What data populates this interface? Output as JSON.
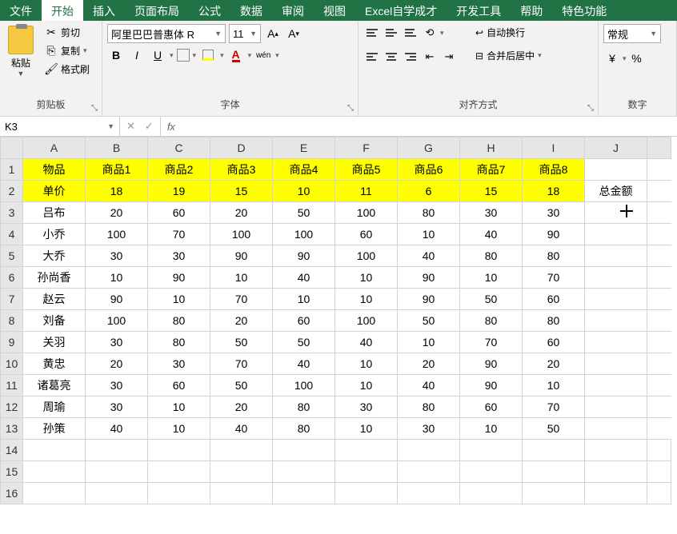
{
  "menubar": {
    "tabs": [
      "文件",
      "开始",
      "插入",
      "页面布局",
      "公式",
      "数据",
      "审阅",
      "视图",
      "Excel自学成才",
      "开发工具",
      "帮助",
      "特色功能"
    ],
    "active_index": 1
  },
  "ribbon": {
    "clipboard": {
      "paste": "粘贴",
      "cut": "剪切",
      "copy": "复制",
      "format_painter": "格式刷",
      "group_label": "剪贴板"
    },
    "font": {
      "family": "阿里巴巴普惠体 R",
      "size": "11",
      "group_label": "字体",
      "wen_label": "wén"
    },
    "alignment": {
      "wrap_text": "自动换行",
      "merge_center": "合并后居中",
      "group_label": "对齐方式"
    },
    "number": {
      "format": "常规",
      "group_label": "数字"
    }
  },
  "name_box": "K3",
  "fx_label": "fx",
  "columns": [
    "A",
    "B",
    "C",
    "D",
    "E",
    "F",
    "G",
    "H",
    "I",
    "J"
  ],
  "row_count": 16,
  "header_row": {
    "label": "物品",
    "items": [
      "商品1",
      "商品2",
      "商品3",
      "商品4",
      "商品5",
      "商品6",
      "商品7",
      "商品8"
    ]
  },
  "price_row": {
    "label": "单价",
    "values": [
      18,
      19,
      15,
      10,
      11,
      6,
      15,
      18
    ],
    "total_label": "总金额"
  },
  "data_rows": [
    {
      "name": "吕布",
      "values": [
        20,
        60,
        20,
        50,
        100,
        80,
        30,
        30
      ]
    },
    {
      "name": "小乔",
      "values": [
        100,
        70,
        100,
        100,
        60,
        10,
        40,
        90
      ]
    },
    {
      "name": "大乔",
      "values": [
        30,
        30,
        90,
        90,
        100,
        40,
        80,
        80
      ]
    },
    {
      "name": "孙尚香",
      "values": [
        10,
        90,
        10,
        40,
        10,
        90,
        10,
        70
      ]
    },
    {
      "name": "赵云",
      "values": [
        90,
        10,
        70,
        10,
        10,
        90,
        50,
        60
      ]
    },
    {
      "name": "刘备",
      "values": [
        100,
        80,
        20,
        60,
        100,
        50,
        80,
        80
      ]
    },
    {
      "name": "关羽",
      "values": [
        30,
        80,
        50,
        50,
        40,
        10,
        70,
        60
      ]
    },
    {
      "name": "黄忠",
      "values": [
        20,
        30,
        70,
        40,
        10,
        20,
        90,
        20
      ]
    },
    {
      "name": "诸葛亮",
      "values": [
        30,
        60,
        50,
        100,
        10,
        40,
        90,
        10
      ]
    },
    {
      "name": "周瑜",
      "values": [
        30,
        10,
        20,
        80,
        30,
        80,
        60,
        70
      ]
    },
    {
      "name": "孙策",
      "values": [
        40,
        10,
        40,
        80,
        10,
        30,
        10,
        50
      ]
    }
  ],
  "col_widths": {
    "rowhdr": 28,
    "A": 78,
    "B": 78,
    "C": 78,
    "D": 78,
    "E": 78,
    "F": 78,
    "G": 78,
    "H": 78,
    "I": 78,
    "J": 78,
    "extra": 30
  }
}
